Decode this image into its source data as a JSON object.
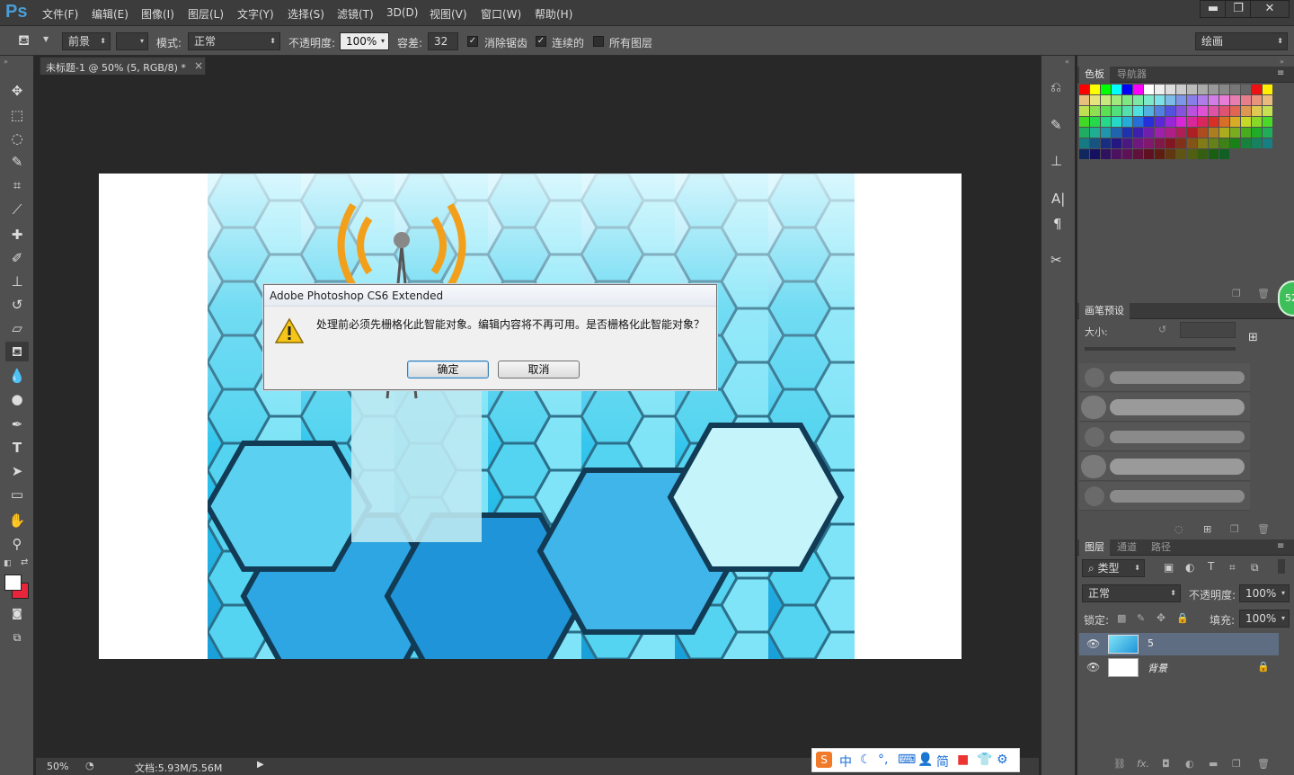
{
  "app": {
    "logo": "Ps"
  },
  "menu": [
    "文件(F)",
    "编辑(E)",
    "图像(I)",
    "图层(L)",
    "文字(Y)",
    "选择(S)",
    "滤镜(T)",
    "3D(D)",
    "视图(V)",
    "窗口(W)",
    "帮助(H)"
  ],
  "window_controls": {
    "minimize": "▬",
    "restore": "❐",
    "close": "✕"
  },
  "options": {
    "fill_source": "前景",
    "mode_label": "模式:",
    "mode_value": "正常",
    "opacity_label": "不透明度:",
    "opacity_value": "100%",
    "tolerance_label": "容差:",
    "tolerance_value": "32",
    "antialias_label": "消除锯齿",
    "antialias_checked": true,
    "contiguous_label": "连续的",
    "contiguous_checked": true,
    "all_layers_label": "所有图层",
    "all_layers_checked": false,
    "workspace": "绘画"
  },
  "document": {
    "tab_title": "未标题-1 @ 50% (5, RGB/8) *",
    "tab_close": "×"
  },
  "status": {
    "zoom": "50%",
    "doc_size": "文档:5.93M/5.56M"
  },
  "dialog": {
    "title": "Adobe Photoshop CS6 Extended",
    "message": "处理前必须先栅格化此智能对象。编辑内容将不再可用。是否栅格化此智能对象？",
    "ok": "确定",
    "cancel": "取消"
  },
  "swatches_panel": {
    "tabs": [
      "色板",
      "导航器"
    ]
  },
  "brush_panel": {
    "title": "画笔预设",
    "size_label": "大小:"
  },
  "layers_panel": {
    "tabs": [
      "图层",
      "通道",
      "路径"
    ],
    "filter": "类型",
    "blend_mode": "正常",
    "opacity_label": "不透明度:",
    "opacity_value": "100%",
    "lock_label": "锁定:",
    "fill_label": "填充:",
    "fill_value": "100%",
    "layers": [
      {
        "name": "5",
        "selected": true
      },
      {
        "name": "背景",
        "selected": false
      }
    ]
  },
  "floating_badge": "52",
  "ime_toolbar": [
    "中",
    "简"
  ],
  "colors": {
    "foreground": "#ffffff",
    "background": "#e8253a",
    "accent": "#4a9ed8"
  }
}
